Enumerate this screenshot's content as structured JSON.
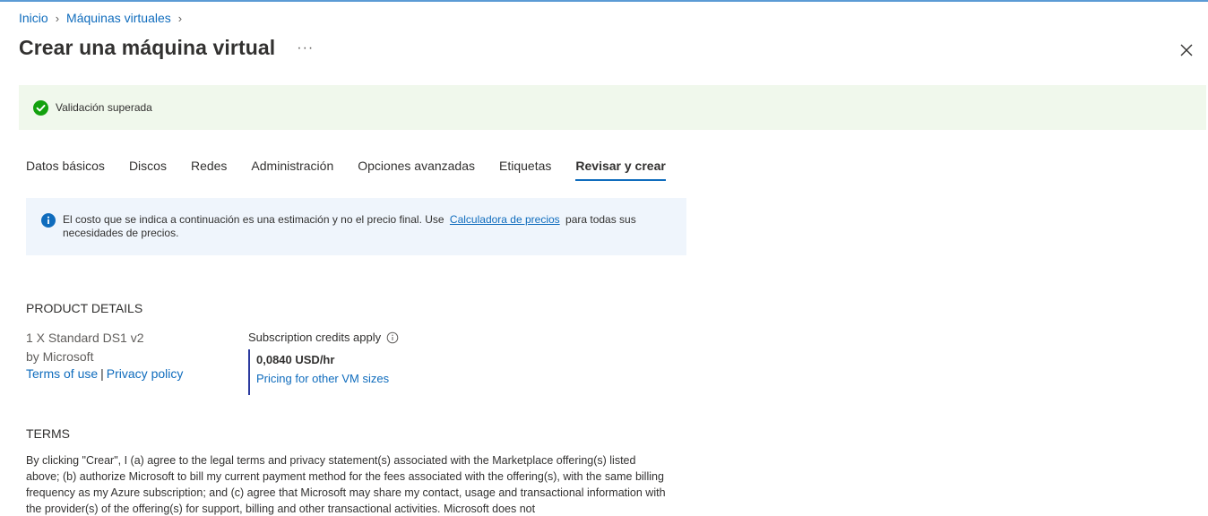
{
  "breadcrumb": {
    "home": "Inicio",
    "vms": "Máquinas virtuales"
  },
  "header": {
    "title": "Crear una máquina virtual",
    "more": "···"
  },
  "validation": {
    "text": "Validación superada",
    "color": "#0e7a0d"
  },
  "tabs": [
    {
      "label": "Datos básicos"
    },
    {
      "label": "Discos"
    },
    {
      "label": "Redes"
    },
    {
      "label": "Administración"
    },
    {
      "label": "Opciones avanzadas"
    },
    {
      "label": "Etiquetas"
    },
    {
      "label": "Revisar y crear",
      "active": true
    }
  ],
  "info": {
    "text_before": "El costo que se indica a continuación es una estimación y no el precio final. Use",
    "link": "Calculadora de precios",
    "text_after": "para todas sus necesidades de precios."
  },
  "product": {
    "heading": "PRODUCT DETAILS",
    "name": "1 X Standard DS1 v2",
    "vendor": "by Microsoft",
    "terms_link": "Terms of use",
    "separator": "|",
    "privacy_link": "Privacy policy",
    "credits_label": "Subscription credits apply",
    "price": "0,0840 USD/hr",
    "pricing_link": "Pricing for other VM sizes"
  },
  "terms": {
    "heading": "TERMS",
    "body": "By clicking \"Crear\", I (a) agree to the legal terms and privacy statement(s) associated with the Marketplace offering(s) listed above; (b) authorize Microsoft to bill my current payment method for the fees associated with the offering(s), with the same billing frequency as my Azure subscription; and (c) agree that Microsoft may share my contact, usage and transactional information with the provider(s) of the offering(s) for support, billing and other transactional activities. Microsoft does not"
  },
  "colors": {
    "accent": "#0f6cbd",
    "success_bg": "#f0f8ec",
    "info_bg": "#eff5fc",
    "price_bar": "#2b3a9e"
  }
}
